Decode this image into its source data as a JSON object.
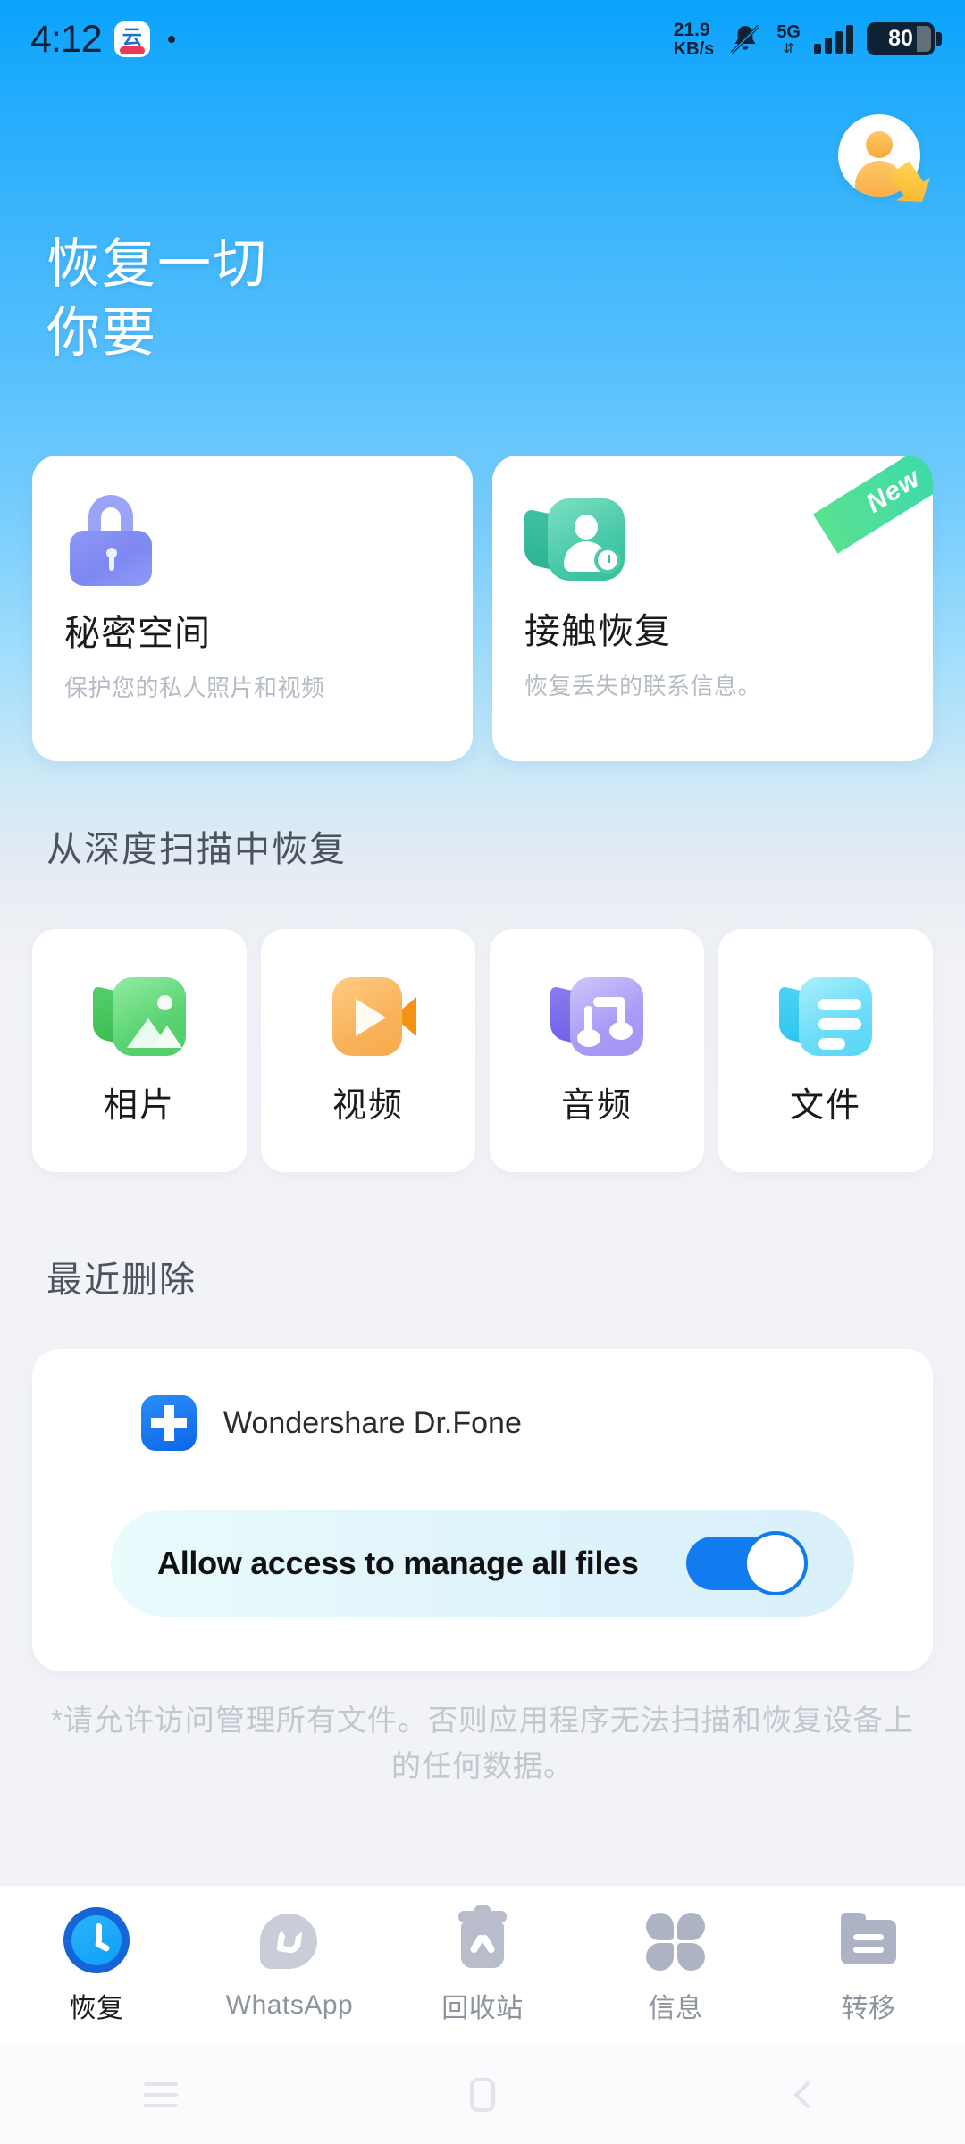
{
  "status_bar": {
    "time": "4:12",
    "app_icon": "cloud-app-icon",
    "network_speed_value": "21.9",
    "network_speed_unit": "KB/s",
    "mute_icon": "bell-muted-icon",
    "network_type": "5G",
    "signal_icon": "signal-bars-icon",
    "battery_level": "80"
  },
  "header": {
    "avatar_icon": "user-avatar-vip-icon",
    "headline_line1": "恢复一切",
    "headline_line2": "你要"
  },
  "feature_cards": [
    {
      "icon": "lock-icon",
      "title": "秘密空间",
      "subtitle": "保护您的私人照片和视频",
      "badge": ""
    },
    {
      "icon": "contact-restore-icon",
      "title": "接触恢复",
      "subtitle": "恢复丢失的联系信息。",
      "badge": "New"
    }
  ],
  "deep_scan": {
    "section_title": "从深度扫描中恢复",
    "items": [
      {
        "icon": "photo-icon",
        "label": "相片"
      },
      {
        "icon": "video-icon",
        "label": "视频"
      },
      {
        "icon": "audio-icon",
        "label": "音频"
      },
      {
        "icon": "file-icon",
        "label": "文件"
      }
    ]
  },
  "recently_deleted": {
    "section_title": "最近删除",
    "app_icon": "drfone-app-icon",
    "app_name": "Wondershare Dr.Fone",
    "permission_label": "Allow access to manage all files",
    "permission_toggle_state": "on",
    "footnote": "*请允许访问管理所有文件。否则应用程序无法扫描和恢复设备上的任何数据。"
  },
  "tab_bar": [
    {
      "icon": "recovery-clock-icon",
      "label": "恢复",
      "active": true
    },
    {
      "icon": "whatsapp-icon",
      "label": "WhatsApp",
      "active": false
    },
    {
      "icon": "trash-bin-icon",
      "label": "回收站",
      "active": false
    },
    {
      "icon": "clover-grid-icon",
      "label": "信息",
      "active": false
    },
    {
      "icon": "transfer-folder-icon",
      "label": "转移",
      "active": false
    }
  ],
  "android_nav": {
    "recents_icon": "recents-icon",
    "home_icon": "home-icon",
    "back_icon": "back-icon"
  },
  "colors": {
    "brand_blue": "#0aa2fb",
    "toggle_on": "#127bf0",
    "new_badge_green": "#36d7b4",
    "card_white": "#ffffff",
    "page_bg": "#f2f3f7"
  }
}
